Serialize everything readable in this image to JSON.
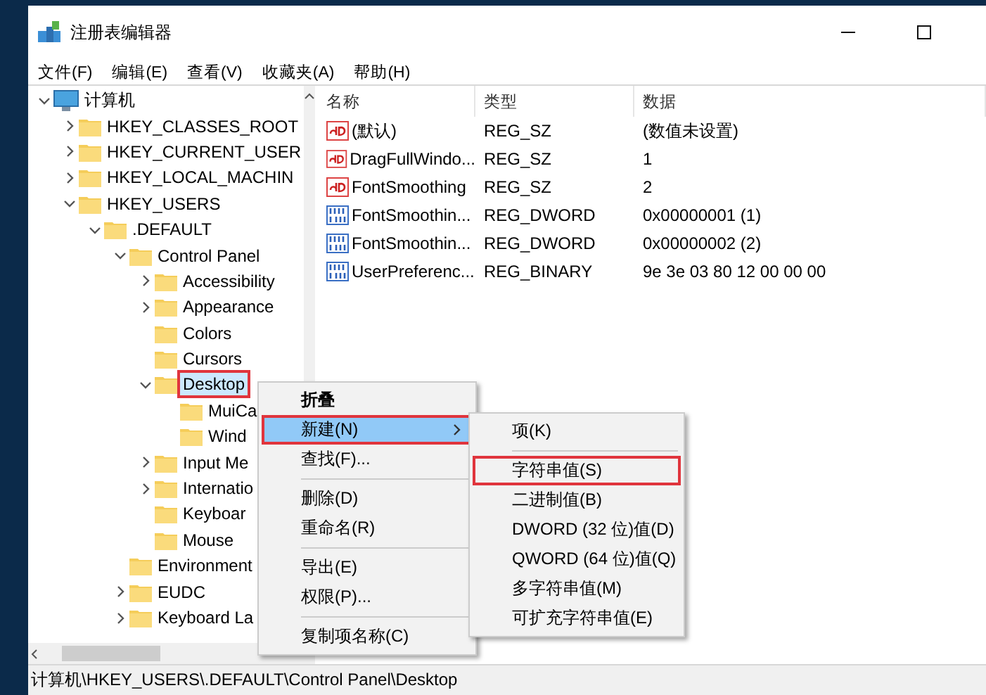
{
  "window": {
    "title": "注册表编辑器"
  },
  "menu_bar": [
    "文件(F)",
    "编辑(E)",
    "查看(V)",
    "收藏夹(A)",
    "帮助(H)"
  ],
  "tree": [
    {
      "label": "计算机",
      "kind": "computer",
      "expandable": true,
      "expanded": true,
      "selected": false,
      "marked": false,
      "children": [
        {
          "label": "HKEY_CLASSES_ROOT",
          "kind": "folder",
          "expandable": true,
          "expanded": false,
          "selected": false,
          "marked": false
        },
        {
          "label": "HKEY_CURRENT_USER",
          "kind": "folder",
          "expandable": true,
          "expanded": false,
          "selected": false,
          "marked": false
        },
        {
          "label": "HKEY_LOCAL_MACHIN",
          "kind": "folder",
          "expandable": true,
          "expanded": false,
          "selected": false,
          "marked": false
        },
        {
          "label": "HKEY_USERS",
          "kind": "folder",
          "expandable": true,
          "expanded": true,
          "selected": false,
          "marked": false,
          "children": [
            {
              "label": ".DEFAULT",
              "kind": "folder",
              "expandable": true,
              "expanded": true,
              "selected": false,
              "marked": false,
              "children": [
                {
                  "label": "Control Panel",
                  "kind": "folder",
                  "expandable": true,
                  "expanded": true,
                  "selected": false,
                  "marked": false,
                  "children": [
                    {
                      "label": "Accessibility",
                      "kind": "folder",
                      "expandable": true,
                      "expanded": false,
                      "selected": false,
                      "marked": false
                    },
                    {
                      "label": "Appearance",
                      "kind": "folder",
                      "expandable": true,
                      "expanded": false,
                      "selected": false,
                      "marked": false
                    },
                    {
                      "label": "Colors",
                      "kind": "folder",
                      "expandable": false,
                      "selected": false,
                      "marked": false
                    },
                    {
                      "label": "Cursors",
                      "kind": "folder",
                      "expandable": false,
                      "selected": false,
                      "marked": false
                    },
                    {
                      "label": "Desktop",
                      "kind": "folder",
                      "expandable": true,
                      "expanded": true,
                      "selected": true,
                      "marked": true,
                      "children": [
                        {
                          "label": "MuiCa",
                          "kind": "folder",
                          "expandable": false,
                          "selected": false,
                          "marked": false
                        },
                        {
                          "label": "Wind",
                          "kind": "folder",
                          "expandable": false,
                          "selected": false,
                          "marked": false
                        }
                      ]
                    },
                    {
                      "label": "Input Me",
                      "kind": "folder",
                      "expandable": true,
                      "expanded": false,
                      "selected": false,
                      "marked": false
                    },
                    {
                      "label": "Internatio",
                      "kind": "folder",
                      "expandable": true,
                      "expanded": false,
                      "selected": false,
                      "marked": false
                    },
                    {
                      "label": "Keyboar",
                      "kind": "folder",
                      "expandable": false,
                      "selected": false,
                      "marked": false
                    },
                    {
                      "label": "Mouse",
                      "kind": "folder",
                      "expandable": false,
                      "selected": false,
                      "marked": false
                    }
                  ]
                },
                {
                  "label": "Environment",
                  "kind": "folder",
                  "expandable": false,
                  "selected": false,
                  "marked": false
                },
                {
                  "label": "EUDC",
                  "kind": "folder",
                  "expandable": true,
                  "expanded": false,
                  "selected": false,
                  "marked": false
                },
                {
                  "label": "Keyboard La",
                  "kind": "folder",
                  "expandable": true,
                  "expanded": false,
                  "selected": false,
                  "marked": false
                }
              ]
            }
          ]
        }
      ]
    }
  ],
  "values": {
    "columns": [
      "名称",
      "类型",
      "数据"
    ],
    "rows": [
      {
        "kind": "string",
        "name": "(默认)",
        "type": "REG_SZ",
        "data": "(数值未设置)"
      },
      {
        "kind": "string",
        "name": "DragFullWindo...",
        "type": "REG_SZ",
        "data": "1"
      },
      {
        "kind": "string",
        "name": "FontSmoothing",
        "type": "REG_SZ",
        "data": "2"
      },
      {
        "kind": "binary",
        "name": "FontSmoothin...",
        "type": "REG_DWORD",
        "data": "0x00000001 (1)"
      },
      {
        "kind": "binary",
        "name": "FontSmoothin...",
        "type": "REG_DWORD",
        "data": "0x00000002 (2)"
      },
      {
        "kind": "binary",
        "name": "UserPreferenc...",
        "type": "REG_BINARY",
        "data": "9e 3e 03 80 12 00 00 00"
      }
    ]
  },
  "context_menu": [
    {
      "kind": "item",
      "label": "折叠",
      "default": true,
      "submenu": false,
      "selected": false,
      "marked": false
    },
    {
      "kind": "item",
      "label": "新建(N)",
      "default": false,
      "submenu": true,
      "selected": true,
      "marked": true
    },
    {
      "kind": "item",
      "label": "查找(F)...",
      "default": false,
      "submenu": false,
      "selected": false,
      "marked": false
    },
    {
      "kind": "separator"
    },
    {
      "kind": "item",
      "label": "删除(D)",
      "default": false,
      "submenu": false,
      "selected": false,
      "marked": false
    },
    {
      "kind": "item",
      "label": "重命名(R)",
      "default": false,
      "submenu": false,
      "selected": false,
      "marked": false
    },
    {
      "kind": "separator"
    },
    {
      "kind": "item",
      "label": "导出(E)",
      "default": false,
      "submenu": false,
      "selected": false,
      "marked": false
    },
    {
      "kind": "item",
      "label": "权限(P)...",
      "default": false,
      "submenu": false,
      "selected": false,
      "marked": false
    },
    {
      "kind": "separator"
    },
    {
      "kind": "item",
      "label": "复制项名称(C)",
      "default": false,
      "submenu": false,
      "selected": false,
      "marked": false
    }
  ],
  "submenu": [
    {
      "kind": "item",
      "label": "项(K)",
      "default": false,
      "selected": false,
      "marked": false
    },
    {
      "kind": "separator"
    },
    {
      "kind": "item",
      "label": "字符串值(S)",
      "default": false,
      "selected": false,
      "marked": true
    },
    {
      "kind": "item",
      "label": "二进制值(B)",
      "default": false,
      "selected": false,
      "marked": false
    },
    {
      "kind": "item",
      "label": "DWORD (32 位)值(D)",
      "default": false,
      "selected": false,
      "marked": false
    },
    {
      "kind": "item",
      "label": "QWORD (64 位)值(Q)",
      "default": false,
      "selected": false,
      "marked": false
    },
    {
      "kind": "item",
      "label": "多字符串值(M)",
      "default": false,
      "selected": false,
      "marked": false
    },
    {
      "kind": "item",
      "label": "可扩充字符串值(E)",
      "default": false,
      "selected": false,
      "marked": false
    }
  ],
  "status_bar": "计算机\\HKEY_USERS\\.DEFAULT\\Control Panel\\Desktop"
}
